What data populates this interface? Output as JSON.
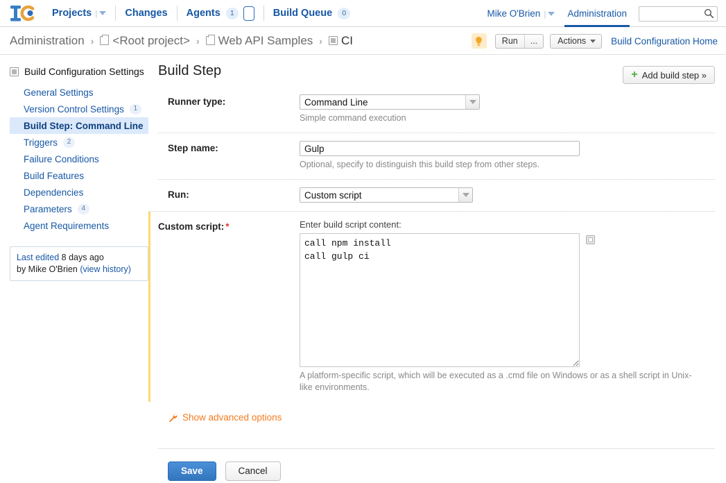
{
  "header": {
    "logo_alt": "teamcity-logo",
    "nav": [
      {
        "label": "Projects",
        "has_caret": true
      },
      {
        "label": "Changes",
        "has_caret": false
      },
      {
        "label": "Agents",
        "badge": "1",
        "has_box": true
      },
      {
        "label": "Build Queue",
        "badge": "0"
      }
    ],
    "user": "Mike O'Brien",
    "admin_tab": "Administration",
    "search_placeholder": "",
    "search_value": ""
  },
  "breadcrumb": {
    "items": [
      {
        "label": "Administration",
        "icon": "none"
      },
      {
        "label": "<Root project>",
        "icon": "project-folder-icon"
      },
      {
        "label": "Web API Samples",
        "icon": "project-folder-icon"
      },
      {
        "label": "CI",
        "icon": "build-config-icon"
      }
    ],
    "separator": "›",
    "actions": {
      "bulb_title": "investigations-icon",
      "run_label": "Run",
      "run_more_label": "...",
      "actions_label": "Actions",
      "home_link": "Build Configuration Home"
    }
  },
  "sidebar": {
    "title": "Build Configuration Settings",
    "items": [
      {
        "label": "General Settings",
        "badge": "",
        "active": false
      },
      {
        "label": "Version Control Settings",
        "badge": "1",
        "active": false
      },
      {
        "label": "Build Step: Command Line",
        "badge": "",
        "active": true
      },
      {
        "label": "Triggers",
        "badge": "2",
        "active": false
      },
      {
        "label": "Failure Conditions",
        "badge": "",
        "active": false
      },
      {
        "label": "Build Features",
        "badge": "",
        "active": false
      },
      {
        "label": "Dependencies",
        "badge": "",
        "active": false
      },
      {
        "label": "Parameters",
        "badge": "4",
        "active": false
      },
      {
        "label": "Agent Requirements",
        "badge": "",
        "active": false
      }
    ],
    "last_edited": {
      "link_label": "Last edited",
      "when": "8 days ago",
      "by": "by Mike O'Brien",
      "history_link": "(view history)"
    }
  },
  "main": {
    "title": "Build Step",
    "add_step_label": "Add build step »",
    "runner_type": {
      "label": "Runner type:",
      "value": "Command Line",
      "options": [
        "Command Line"
      ],
      "hint": "Simple command execution"
    },
    "step_name": {
      "label": "Step name:",
      "value": "Gulp",
      "hint": "Optional, specify to distinguish this build step from other steps."
    },
    "run": {
      "label": "Run:",
      "value": "Custom script",
      "options": [
        "Custom script"
      ]
    },
    "custom_script": {
      "label": "Custom script:",
      "required_mark": "*",
      "sublabel": "Enter build script content:",
      "value": "call npm install\ncall gulp ci",
      "hint": "A platform-specific script, which will be executed as a .cmd file on Windows or as a shell script in Unix-like environments."
    },
    "advanced_link": "Show advanced options",
    "save_label": "Save",
    "cancel_label": "Cancel"
  },
  "colors": {
    "link_blue": "#1758a5",
    "accent_yellow": "#fcdb6c",
    "orange": "#f57c20",
    "green": "#4fae3f",
    "required_red": "#d63b2e",
    "save_blue": "#3276bd"
  }
}
